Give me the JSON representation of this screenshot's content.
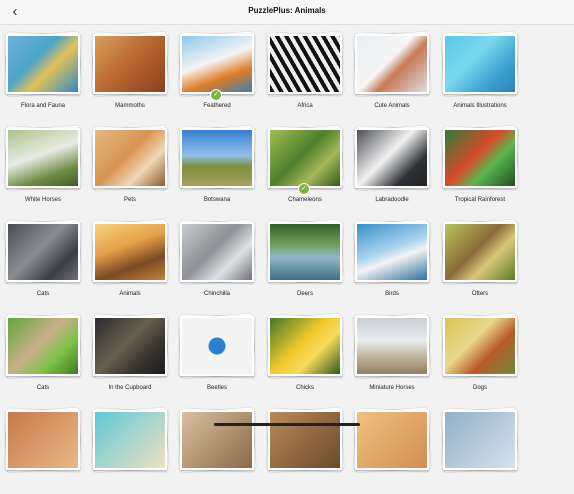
{
  "header": {
    "title": "PuzzlePlus: Animals",
    "back_icon": "chevron-left-icon"
  },
  "check_icon": "✓",
  "puzzles": [
    {
      "label": "Flora and Fauna",
      "bg": "linear-gradient(135deg,#6fb3d9,#4aa3c9 40%,#e3c15a 60%,#2f8ac0)",
      "checked": false
    },
    {
      "label": "Mammoths",
      "bg": "linear-gradient(135deg,#d9a05b,#b9662f 50%,#8a3f1f)",
      "checked": false
    },
    {
      "label": "Feathered",
      "bg": "linear-gradient(160deg,#8fc8ea,#f4f4f4 45%,#e07b25 70%,#3d7fb0)",
      "checked": true
    },
    {
      "label": "Africa",
      "bg": "repeating-linear-gradient(60deg,#111 0 4px,#eee 4px 8px)",
      "checked": false
    },
    {
      "label": "Cute Animals",
      "bg": "linear-gradient(135deg,#e9eef2,#f5f5f5 45%,#c77a55 60%,#d9dde2)",
      "checked": false
    },
    {
      "label": "Animals Illustrations",
      "bg": "linear-gradient(135deg,#57c8e6,#7cd7ef 40%,#3fa6d1 70%,#2c7fb8)",
      "checked": false
    },
    {
      "label": "White Horses",
      "bg": "linear-gradient(160deg,#aac489,#e8ebe2 45%,#6d8d45 75%,#3f5e2a)",
      "checked": false
    },
    {
      "label": "Pets",
      "bg": "linear-gradient(135deg,#e6b882,#d89352 45%,#f0d7b5 70%,#8c5a2e)",
      "checked": false
    },
    {
      "label": "Botswana",
      "bg": "linear-gradient(180deg,#3a7fd1,#8fc0ea 45%,#7d8f3d 65%,#a7a15e)",
      "checked": false
    },
    {
      "label": "Chameleons",
      "bg": "linear-gradient(135deg,#9fbf55,#4f7f2a 45%,#a4b85a 70%,#2f5a1e)",
      "checked": true
    },
    {
      "label": "Labradoodle",
      "bg": "linear-gradient(135deg,#4c4f55,#f1f1f1 45%,#2e3136 75%,#222)",
      "checked": false
    },
    {
      "label": "Tropical Rainforest",
      "bg": "linear-gradient(135deg,#2f7a3a,#d94a2a 45%,#5ab84e 65%,#1d4f24)",
      "checked": false
    },
    {
      "label": "Cats",
      "bg": "linear-gradient(135deg,#4a4d52,#8a8d92 45%,#3a3d42 75%,#6f7277)",
      "checked": false
    },
    {
      "label": "Animals",
      "bg": "linear-gradient(160deg,#f7d27a,#e6a04a 40%,#7a4a22 70%,#c8823c)",
      "checked": false
    },
    {
      "label": "Chinchilla",
      "bg": "linear-gradient(135deg,#c9cccf,#8d9094 45%,#dfe2e5 70%,#6d7074)",
      "checked": false
    },
    {
      "label": "Deers",
      "bg": "linear-gradient(180deg,#2f5f2a,#6f9f55 35%,#8fb7c9 60%,#3e6f80)",
      "checked": false
    },
    {
      "label": "Birds",
      "bg": "linear-gradient(160deg,#3a8fc9,#a8d2ee 45%,#f4f4f4 60%,#2d6f9a)",
      "checked": false
    },
    {
      "label": "Otters",
      "bg": "linear-gradient(135deg,#b9c55a,#8a6a3a 45%,#d9c778 65%,#5a7a2a)",
      "checked": false
    },
    {
      "label": "Cats",
      "bg": "linear-gradient(135deg,#5fa83a,#c9b08a 45%,#7cc24a 70%,#3f7a22)",
      "checked": false
    },
    {
      "label": "In the Cupboard",
      "bg": "linear-gradient(135deg,#2a2d30,#6a5f4f 45%,#3a3630 70%,#1a1b1c)",
      "checked": false
    },
    {
      "label": "Beetles",
      "bg": "radial-gradient(circle at 50% 50%,#2a7fd1 0 8px,#f4f4f4 9px)",
      "checked": false
    },
    {
      "label": "Chicks",
      "bg": "linear-gradient(135deg,#3f7a2a,#f2c82a 45%,#f6dc5a 65%,#2f5a1e)",
      "checked": false
    },
    {
      "label": "Miniature Horses",
      "bg": "linear-gradient(180deg,#c9cfd4,#e9ecee 40%,#b8a98f 75%,#8f7f66)",
      "checked": false
    },
    {
      "label": "Dogs",
      "bg": "linear-gradient(135deg,#d9c25a,#e8d98a 40%,#b85a2a 65%,#6f8a3a)",
      "checked": false
    },
    {
      "label": "",
      "bg": "linear-gradient(135deg,#c77a4a,#e8b88a)",
      "checked": false
    },
    {
      "label": "",
      "bg": "linear-gradient(135deg,#5fc9d9,#f0e0c0)",
      "checked": false
    },
    {
      "label": "",
      "bg": "linear-gradient(135deg,#d9c0a0,#8a6a4a)",
      "checked": false
    },
    {
      "label": "",
      "bg": "linear-gradient(135deg,#b88a5a,#6a4a2a)",
      "checked": false
    },
    {
      "label": "",
      "bg": "linear-gradient(135deg,#f0c080,#d09050)",
      "checked": false
    },
    {
      "label": "",
      "bg": "linear-gradient(135deg,#8fb0c9,#d9e2ea)",
      "checked": false
    }
  ]
}
